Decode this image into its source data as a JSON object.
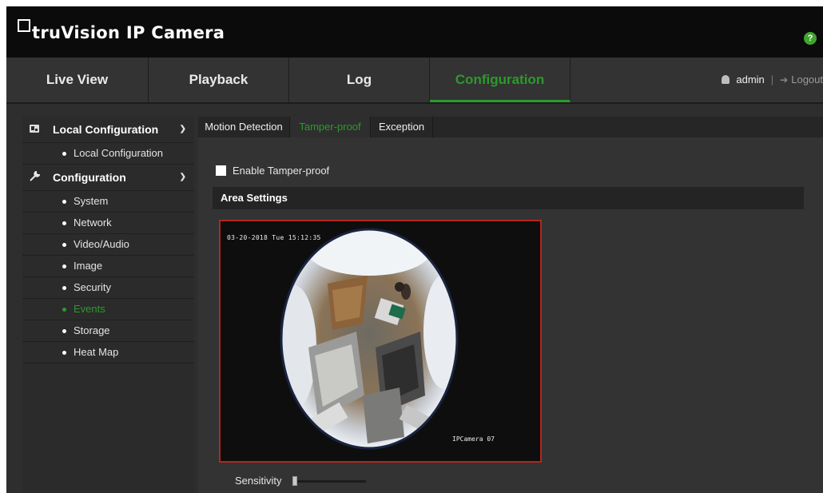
{
  "header": {
    "brand": "truVision",
    "product": "IP Camera",
    "help_label": "?",
    "help_icon": "question-circle",
    "accent_color": "#2c9a2c"
  },
  "nav": {
    "tabs": [
      {
        "label": "Live View",
        "active": false
      },
      {
        "label": "Playback",
        "active": false
      },
      {
        "label": "Log",
        "active": false
      },
      {
        "label": "Configuration",
        "active": true
      }
    ],
    "user": "admin",
    "separator": "|",
    "logout": "Logout"
  },
  "sidebar": {
    "groups": [
      {
        "label": "Local Configuration",
        "icon": "local-config-icon",
        "items": [
          "Local Configuration"
        ]
      },
      {
        "label": "Configuration",
        "icon": "wrench-icon",
        "items": [
          "System",
          "Network",
          "Video/Audio",
          "Image",
          "Security",
          "Events",
          "Storage",
          "Heat Map"
        ]
      }
    ],
    "active_item": "Events"
  },
  "subtabs": [
    {
      "label": "Motion Detection",
      "active": false
    },
    {
      "label": "Tamper-proof",
      "active": true
    },
    {
      "label": "Exception",
      "active": false
    }
  ],
  "tamper": {
    "enable_label": "Enable Tamper-proof",
    "enabled": false,
    "area_settings_title": "Area Settings",
    "osd_timestamp": "03-20-2018 Tue 15:12:35",
    "osd_camera_name": "IPCamera 07",
    "area_border_color": "#b3261e",
    "sensitivity_label": "Sensitivity",
    "sensitivity_value": 0
  }
}
